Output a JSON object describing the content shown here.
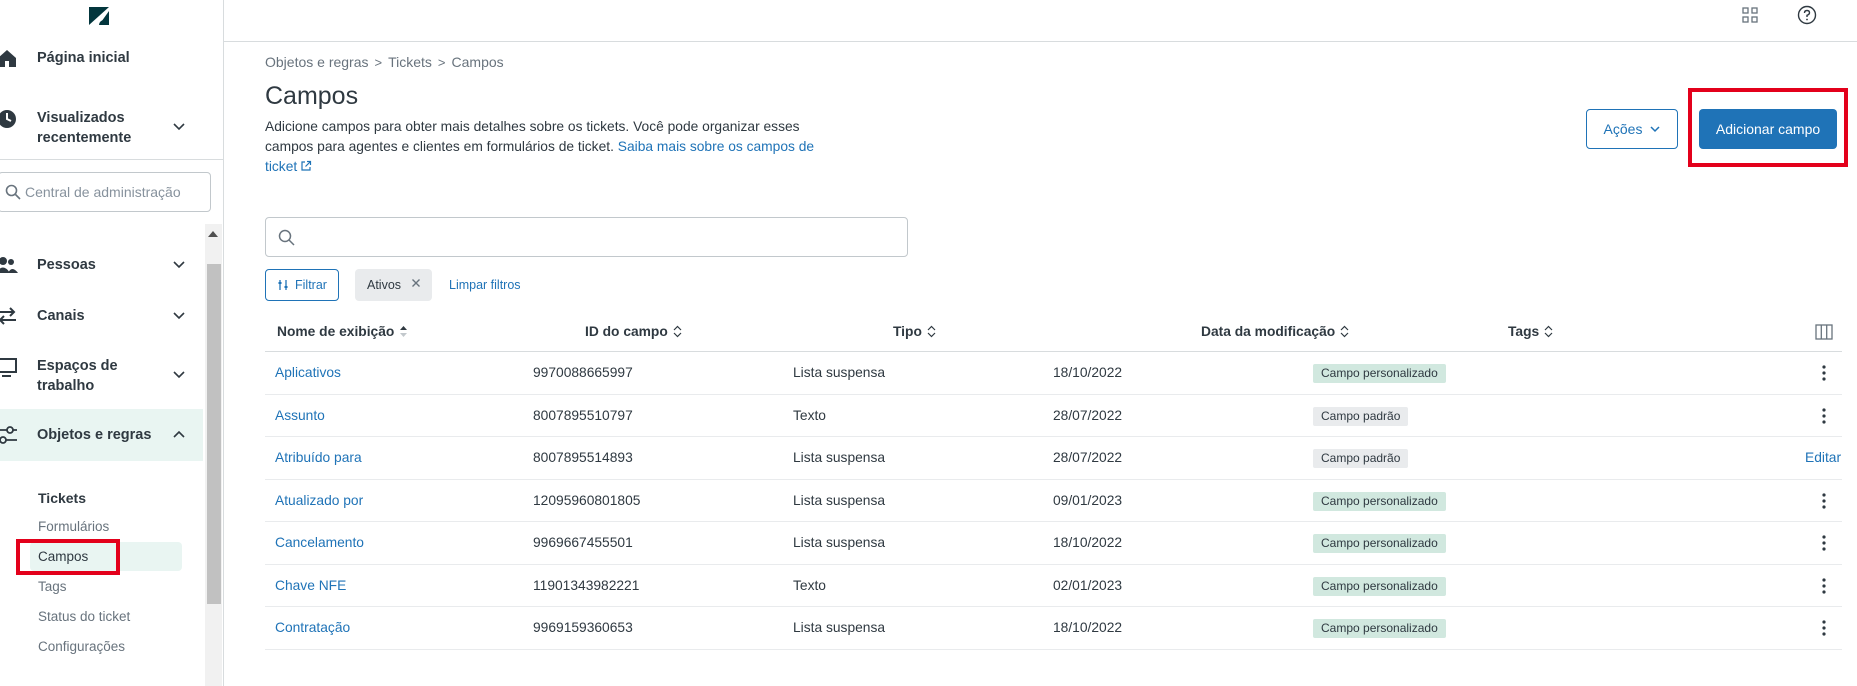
{
  "sidebar": {
    "home": "Página inicial",
    "recent": "Visualizados recentemente",
    "search_placeholder": "Central de administração",
    "items": [
      {
        "label": "Pessoas"
      },
      {
        "label": "Canais"
      },
      {
        "label": "Espaços de trabalho"
      },
      {
        "label": "Objetos e regras"
      }
    ],
    "sub_header": "Tickets",
    "sub_items": [
      "Formulários",
      "Campos",
      "Tags",
      "Status do ticket",
      "Configurações"
    ]
  },
  "breadcrumb": [
    "Objetos e regras",
    "Tickets",
    "Campos"
  ],
  "breadcrumb_sep": ">",
  "page": {
    "title": "Campos",
    "description": "Adicione campos para obter mais detalhes sobre os tickets. Você pode organizar esses campos para agentes e clientes em formulários de ticket.",
    "learn_more": "Saiba mais sobre os campos de ticket"
  },
  "buttons": {
    "actions": "Ações",
    "add": "Adicionar campo",
    "filter": "Filtrar",
    "active_chip": "Ativos",
    "clear": "Limpar filtros"
  },
  "table": {
    "headers": [
      "Nome de exibição",
      "ID do campo",
      "Tipo",
      "Data da modificação",
      "Tags"
    ],
    "rows": [
      {
        "name": "Aplicativos",
        "id": "9970088665997",
        "type": "Lista suspensa",
        "date": "18/10/2022",
        "tag": "Campo personalizado",
        "tag_kind": "custom",
        "action": "menu"
      },
      {
        "name": "Assunto",
        "id": "8007895510797",
        "type": "Texto",
        "date": "28/07/2022",
        "tag": "Campo padrão",
        "tag_kind": "default",
        "action": "menu"
      },
      {
        "name": "Atribuído para",
        "id": "8007895514893",
        "type": "Lista suspensa",
        "date": "28/07/2022",
        "tag": "Campo padrão",
        "tag_kind": "default",
        "action": "Editar"
      },
      {
        "name": "Atualizado por",
        "id": "12095960801805",
        "type": "Lista suspensa",
        "date": "09/01/2023",
        "tag": "Campo personalizado",
        "tag_kind": "custom",
        "action": "menu"
      },
      {
        "name": "Cancelamento",
        "id": "9969667455501",
        "type": "Lista suspensa",
        "date": "18/10/2022",
        "tag": "Campo personalizado",
        "tag_kind": "custom",
        "action": "menu"
      },
      {
        "name": "Chave NFE",
        "id": "11901343982221",
        "type": "Texto",
        "date": "02/01/2023",
        "tag": "Campo personalizado",
        "tag_kind": "custom",
        "action": "menu"
      },
      {
        "name": "Contratação",
        "id": "9969159360653",
        "type": "Lista suspensa",
        "date": "18/10/2022",
        "tag": "Campo personalizado",
        "tag_kind": "custom",
        "action": "menu"
      }
    ]
  },
  "colors": {
    "accent": "#1f73b7",
    "highlight": "#e3001b",
    "active_nav_bg": "#e9f5f2",
    "custom_tag_bg": "#d1e8df"
  },
  "icons": [
    "zendesk-logo",
    "home-icon",
    "clock-icon",
    "search-icon",
    "people-icon",
    "channels-icon",
    "workspace-icon",
    "objects-rules-icon",
    "apps-grid-icon",
    "help-icon",
    "external-link-icon",
    "filter-icon",
    "close-icon",
    "sort-icon",
    "columns-icon",
    "kebab-menu-icon"
  ]
}
